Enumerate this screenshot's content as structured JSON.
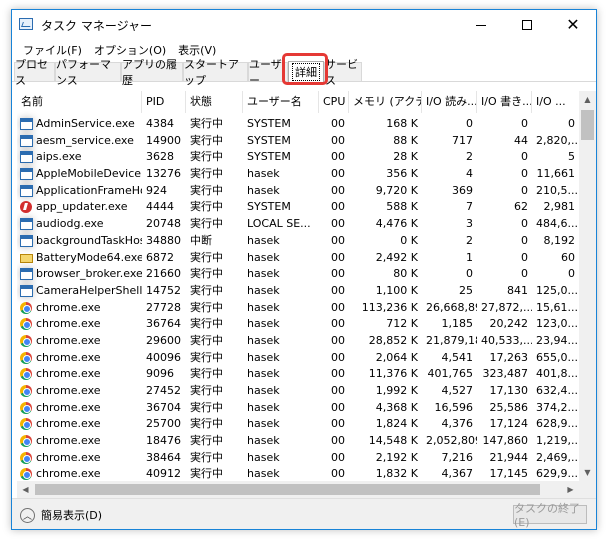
{
  "window": {
    "title": "タスク マネージャー",
    "icons": {
      "app": "task-manager-icon",
      "minimize": "minimize-icon",
      "maximize": "maximize-icon",
      "close": "close-icon"
    },
    "close_glyph": "✕"
  },
  "menu": [
    "ファイル(F)",
    "オプション(O)",
    "表示(V)"
  ],
  "tabs": [
    "プロセス",
    "パフォーマンス",
    "アプリの履歴",
    "スタートアップ",
    "ユーザー",
    "詳細",
    "サービス"
  ],
  "active_tab": "詳細",
  "highlight_color": "#e53935",
  "accent_color": "#1883d7",
  "columns": [
    "名前",
    "PID",
    "状態",
    "ユーザー名",
    "CPU",
    "メモリ (アクテ...",
    "I/O 読み...",
    "I/O 書き...",
    "I/O ..."
  ],
  "rows": [
    {
      "icon": "window",
      "name": "AdminService.exe",
      "pid": "4384",
      "status": "実行中",
      "user": "SYSTEM",
      "cpu": "00",
      "mem": "168 K",
      "io_read": "0",
      "io_write": "0",
      "io_other": "0"
    },
    {
      "icon": "window",
      "name": "aesm_service.exe",
      "pid": "14900",
      "status": "実行中",
      "user": "SYSTEM",
      "cpu": "00",
      "mem": "88 K",
      "io_read": "717",
      "io_write": "44",
      "io_other": "2,820,..."
    },
    {
      "icon": "window",
      "name": "aips.exe",
      "pid": "3628",
      "status": "実行中",
      "user": "SYSTEM",
      "cpu": "00",
      "mem": "28 K",
      "io_read": "2",
      "io_write": "0",
      "io_other": "5"
    },
    {
      "icon": "window",
      "name": "AppleMobileDeviceP...",
      "pid": "13276",
      "status": "実行中",
      "user": "hasek",
      "cpu": "00",
      "mem": "356 K",
      "io_read": "4",
      "io_write": "0",
      "io_other": "11,661"
    },
    {
      "icon": "window",
      "name": "ApplicationFrameHo...",
      "pid": "924",
      "status": "実行中",
      "user": "hasek",
      "cpu": "00",
      "mem": "9,720 K",
      "io_read": "369",
      "io_write": "0",
      "io_other": "210,5..."
    },
    {
      "icon": "updater",
      "name": "app_updater.exe",
      "pid": "4444",
      "status": "実行中",
      "user": "SYSTEM",
      "cpu": "00",
      "mem": "588 K",
      "io_read": "7",
      "io_write": "62",
      "io_other": "2,981"
    },
    {
      "icon": "window",
      "name": "audiodg.exe",
      "pid": "20748",
      "status": "実行中",
      "user": "LOCAL SE...",
      "cpu": "00",
      "mem": "4,476 K",
      "io_read": "3",
      "io_write": "0",
      "io_other": "484,6..."
    },
    {
      "icon": "window",
      "name": "backgroundTaskHos...",
      "pid": "34880",
      "status": "中断",
      "user": "hasek",
      "cpu": "00",
      "mem": "0 K",
      "io_read": "2",
      "io_write": "0",
      "io_other": "8,192"
    },
    {
      "icon": "battery",
      "name": "BatteryMode64.exe",
      "pid": "6872",
      "status": "実行中",
      "user": "hasek",
      "cpu": "00",
      "mem": "2,492 K",
      "io_read": "1",
      "io_write": "0",
      "io_other": "60"
    },
    {
      "icon": "window",
      "name": "browser_broker.exe",
      "pid": "21660",
      "status": "実行中",
      "user": "hasek",
      "cpu": "00",
      "mem": "80 K",
      "io_read": "0",
      "io_write": "0",
      "io_other": "0"
    },
    {
      "icon": "window",
      "name": "CameraHelperShell.e...",
      "pid": "14752",
      "status": "実行中",
      "user": "hasek",
      "cpu": "00",
      "mem": "1,100 K",
      "io_read": "25",
      "io_write": "841",
      "io_other": "125,0..."
    },
    {
      "icon": "chrome",
      "name": "chrome.exe",
      "pid": "27728",
      "status": "実行中",
      "user": "hasek",
      "cpu": "00",
      "mem": "113,236 K",
      "io_read": "26,668,896",
      "io_write": "27,872,...",
      "io_other": "15,61..."
    },
    {
      "icon": "chrome",
      "name": "chrome.exe",
      "pid": "36764",
      "status": "実行中",
      "user": "hasek",
      "cpu": "00",
      "mem": "712 K",
      "io_read": "1,185",
      "io_write": "20,242",
      "io_other": "123,0..."
    },
    {
      "icon": "chrome",
      "name": "chrome.exe",
      "pid": "29600",
      "status": "実行中",
      "user": "hasek",
      "cpu": "00",
      "mem": "28,852 K",
      "io_read": "21,879,183",
      "io_write": "40,533,...",
      "io_other": "23,94..."
    },
    {
      "icon": "chrome",
      "name": "chrome.exe",
      "pid": "40096",
      "status": "実行中",
      "user": "hasek",
      "cpu": "00",
      "mem": "2,064 K",
      "io_read": "4,541",
      "io_write": "17,263",
      "io_other": "655,0..."
    },
    {
      "icon": "chrome",
      "name": "chrome.exe",
      "pid": "9096",
      "status": "実行中",
      "user": "hasek",
      "cpu": "00",
      "mem": "11,376 K",
      "io_read": "401,765",
      "io_write": "323,487",
      "io_other": "401,8..."
    },
    {
      "icon": "chrome",
      "name": "chrome.exe",
      "pid": "27452",
      "status": "実行中",
      "user": "hasek",
      "cpu": "00",
      "mem": "1,992 K",
      "io_read": "4,527",
      "io_write": "17,130",
      "io_other": "632,4..."
    },
    {
      "icon": "chrome",
      "name": "chrome.exe",
      "pid": "36704",
      "status": "実行中",
      "user": "hasek",
      "cpu": "00",
      "mem": "4,368 K",
      "io_read": "16,596",
      "io_write": "25,586",
      "io_other": "374,2..."
    },
    {
      "icon": "chrome",
      "name": "chrome.exe",
      "pid": "25700",
      "status": "実行中",
      "user": "hasek",
      "cpu": "00",
      "mem": "1,824 K",
      "io_read": "4,376",
      "io_write": "17,124",
      "io_other": "628,9..."
    },
    {
      "icon": "chrome",
      "name": "chrome.exe",
      "pid": "18476",
      "status": "実行中",
      "user": "hasek",
      "cpu": "00",
      "mem": "14,548 K",
      "io_read": "2,052,809",
      "io_write": "147,860",
      "io_other": "1,219,..."
    },
    {
      "icon": "chrome",
      "name": "chrome.exe",
      "pid": "38464",
      "status": "実行中",
      "user": "hasek",
      "cpu": "00",
      "mem": "2,192 K",
      "io_read": "7,216",
      "io_write": "21,944",
      "io_other": "2,469,..."
    },
    {
      "icon": "chrome",
      "name": "chrome.exe",
      "pid": "40912",
      "status": "実行中",
      "user": "hasek",
      "cpu": "00",
      "mem": "1,832 K",
      "io_read": "4,367",
      "io_write": "17,145",
      "io_other": "629,9..."
    }
  ],
  "footer": {
    "fewer_details": "簡易表示(D)",
    "end_task": "タスクの終了(E)",
    "icons": {
      "fewer": "chevron-up-icon"
    }
  },
  "scroll_glyphs": {
    "up": "▲",
    "down": "▼",
    "left": "◀",
    "right": "▶"
  }
}
